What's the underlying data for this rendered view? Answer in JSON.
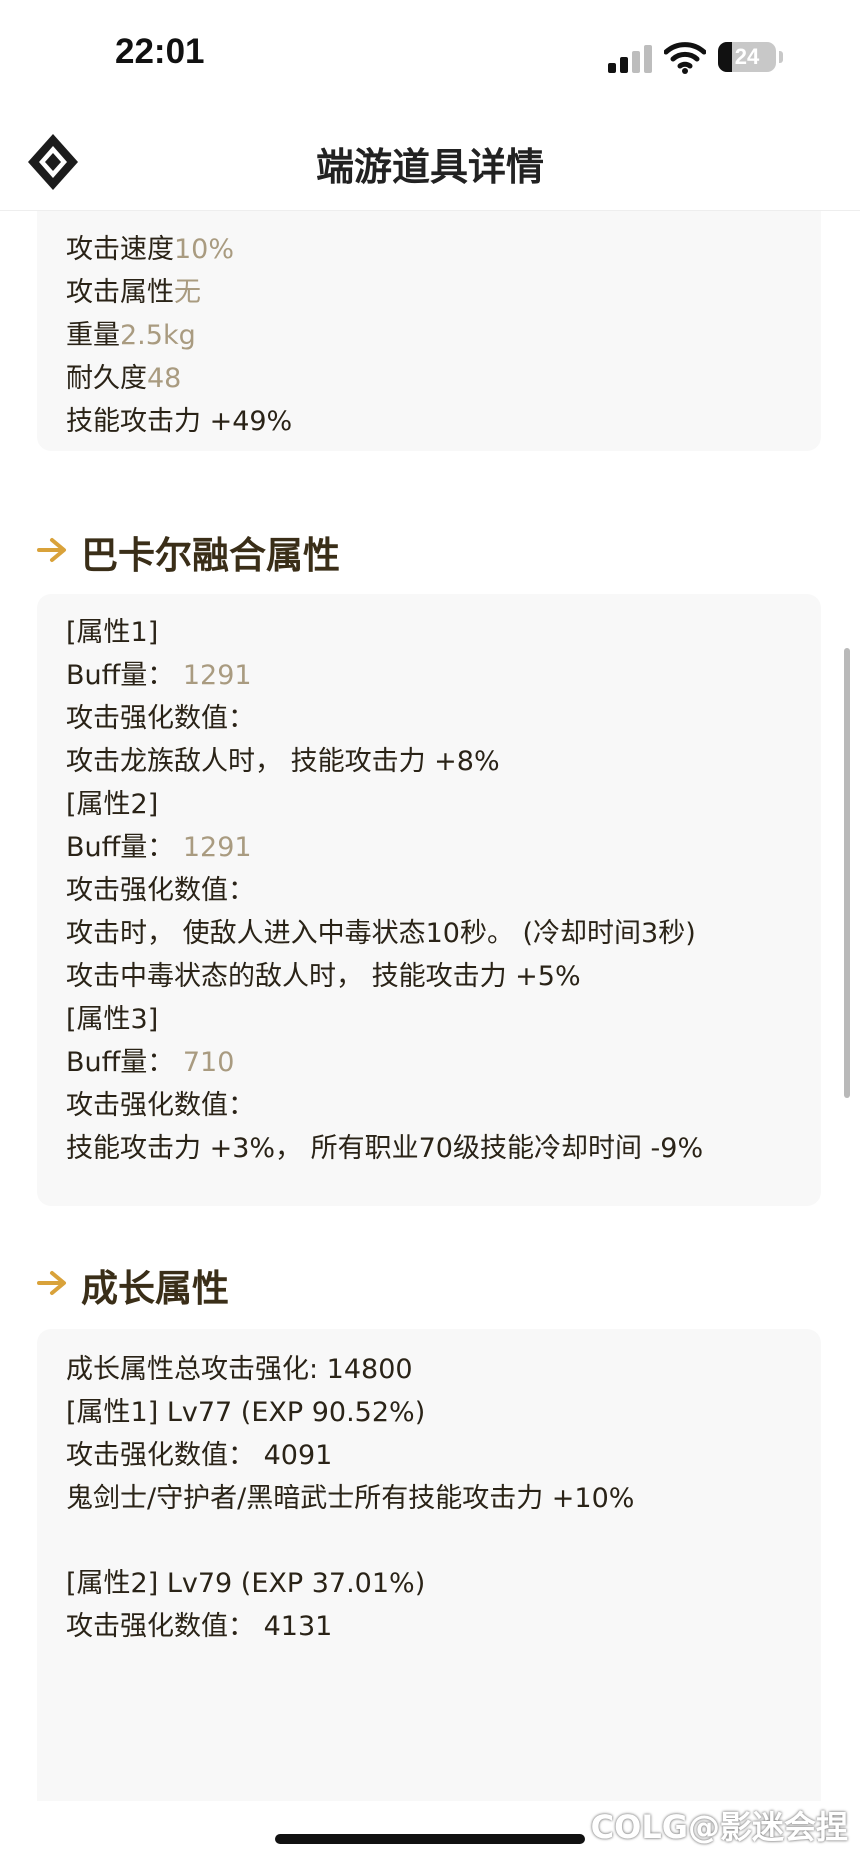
{
  "status_bar": {
    "time": "22:01",
    "battery": "24",
    "battery_level": 0.24
  },
  "nav": {
    "title": "端游道具详情",
    "logo_icon": "diamond-logo-icon"
  },
  "stats_card": [
    {
      "label": "攻击速度",
      "value": "10%"
    },
    {
      "label": "攻击属性",
      "value": "无"
    },
    {
      "label": "重量",
      "value": "2.5kg"
    },
    {
      "label": "耐久度",
      "value": "48"
    },
    {
      "label": "技能攻击力 +49%",
      "value": ""
    }
  ],
  "bakal_section": {
    "title": "巴卡尔融合属性",
    "icon": "arrow-right-icon",
    "lines": [
      {
        "label": "[属性1]",
        "value": ""
      },
      {
        "label": "Buff量：",
        "value": "1291"
      },
      {
        "label": "攻击强化数值：",
        "value": ""
      },
      {
        "label": "攻击龙族敌人时， 技能攻击力 +8%",
        "value": ""
      },
      {
        "label": "[属性2]",
        "value": ""
      },
      {
        "label": "Buff量：",
        "value": "1291"
      },
      {
        "label": "攻击强化数值：",
        "value": ""
      },
      {
        "label": "攻击时， 使敌人进入中毒状态10秒。 (冷却时间3秒)",
        "value": ""
      },
      {
        "label": "攻击中毒状态的敌人时， 技能攻击力 +5%",
        "value": ""
      },
      {
        "label": "[属性3]",
        "value": ""
      },
      {
        "label": "Buff量：",
        "value": "710"
      },
      {
        "label": "攻击强化数值：",
        "value": ""
      },
      {
        "label": "技能攻击力 +3%， 所有职业70级技能冷却时间 -9%",
        "value": ""
      }
    ]
  },
  "growth_section": {
    "title": "成长属性",
    "icon": "arrow-right-icon",
    "lines": [
      "成长属性总攻击强化: 14800",
      "[属性1] Lv77 (EXP 90.52%)",
      "攻击强化数值： 4091",
      "鬼剑士/守护者/黑暗武士所有技能攻击力 +10%",
      "",
      "[属性2] Lv79 (EXP 37.01%)",
      "攻击强化数值： 4131"
    ]
  },
  "watermark": "@影迷会捏",
  "watermark_logo": "COLG",
  "colors": {
    "value_text": "#a99b80",
    "accent": "#d9a23a",
    "card_bg": "#f8f8f8"
  }
}
